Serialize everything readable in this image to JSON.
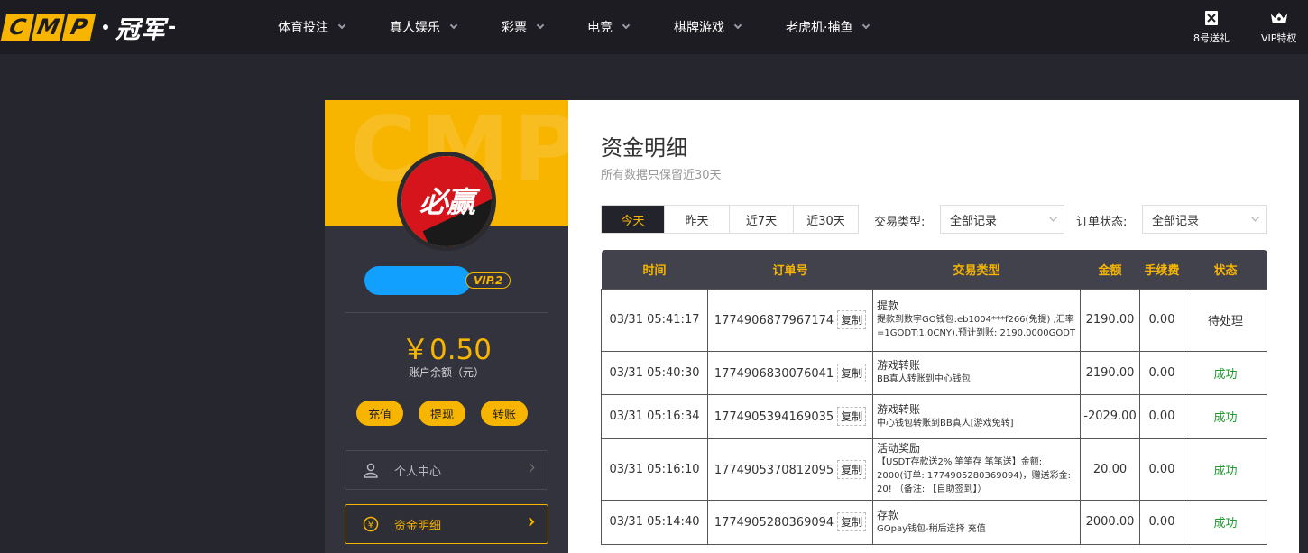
{
  "brand": {
    "logo_letters": [
      "C",
      "M",
      "P"
    ],
    "logo_text": "冠军",
    "accent": "#f7b500"
  },
  "nav": {
    "items": [
      {
        "label": "体育投注"
      },
      {
        "label": "真人娱乐"
      },
      {
        "label": "彩票"
      },
      {
        "label": "电竞"
      },
      {
        "label": "棋牌游戏"
      },
      {
        "label": "老虎机·捕鱼"
      }
    ],
    "right": [
      {
        "label": "8号送礼",
        "icon": "gift-icon"
      },
      {
        "label": "VIP特权",
        "icon": "crown-icon"
      }
    ]
  },
  "sidebar": {
    "avatar_text": "必赢",
    "vip": "VIP.2",
    "balance": "￥0.50",
    "balance_label": "账户余额（元）",
    "actions": [
      {
        "label": "充值"
      },
      {
        "label": "提现"
      },
      {
        "label": "转账"
      }
    ],
    "menu": [
      {
        "label": "个人中心",
        "icon": "user-icon"
      },
      {
        "label": "资金明细",
        "icon": "coin-icon"
      }
    ]
  },
  "main": {
    "title": "资金明细",
    "subtitle": "所有数据只保留近30天",
    "tabs": [
      {
        "label": "今天"
      },
      {
        "label": "昨天"
      },
      {
        "label": "近7天"
      },
      {
        "label": "近30天"
      }
    ],
    "filter_type_label": "交易类型:",
    "filter_type_value": "全部记录",
    "filter_status_label": "订单状态:",
    "filter_status_value": "全部记录",
    "columns": [
      "时间",
      "订单号",
      "交易类型",
      "金额",
      "手续费",
      "状态"
    ],
    "copy_label": "复制",
    "rows": [
      {
        "time": "03/31 05:41:17",
        "order": "1774906877967174",
        "type": "提款",
        "detail": "提款到数字GO钱包:eb1004***f266(免提) ,汇率=1GODT:1.0CNY),预计到账: 2190.0000GODT",
        "amount": "2190.00",
        "fee": "0.00",
        "status": "待处理"
      },
      {
        "time": "03/31 05:40:30",
        "order": "1774906830076041",
        "type": "游戏转账",
        "detail": "BB真人转账到中心钱包",
        "amount": "2190.00",
        "fee": "0.00",
        "status": "成功"
      },
      {
        "time": "03/31 05:16:34",
        "order": "1774905394169035",
        "type": "游戏转账",
        "detail": "中心钱包转账到BB真人[游戏免转]",
        "amount": "-2029.00",
        "fee": "0.00",
        "status": "成功"
      },
      {
        "time": "03/31 05:16:10",
        "order": "1774905370812095",
        "type": "活动奖励",
        "detail": "【USDT存款送2% 笔笔存 笔笔送】金额: 2000(订单: 1774905280369094)，赠送彩金: 20! （备注: 【自助签到】）",
        "amount": "20.00",
        "fee": "0.00",
        "status": "成功"
      },
      {
        "time": "03/31 05:14:40",
        "order": "1774905280369094",
        "type": "存款",
        "detail": "GOpay钱包-稍后选择 充值",
        "amount": "2000.00",
        "fee": "0.00",
        "status": "成功"
      }
    ]
  }
}
